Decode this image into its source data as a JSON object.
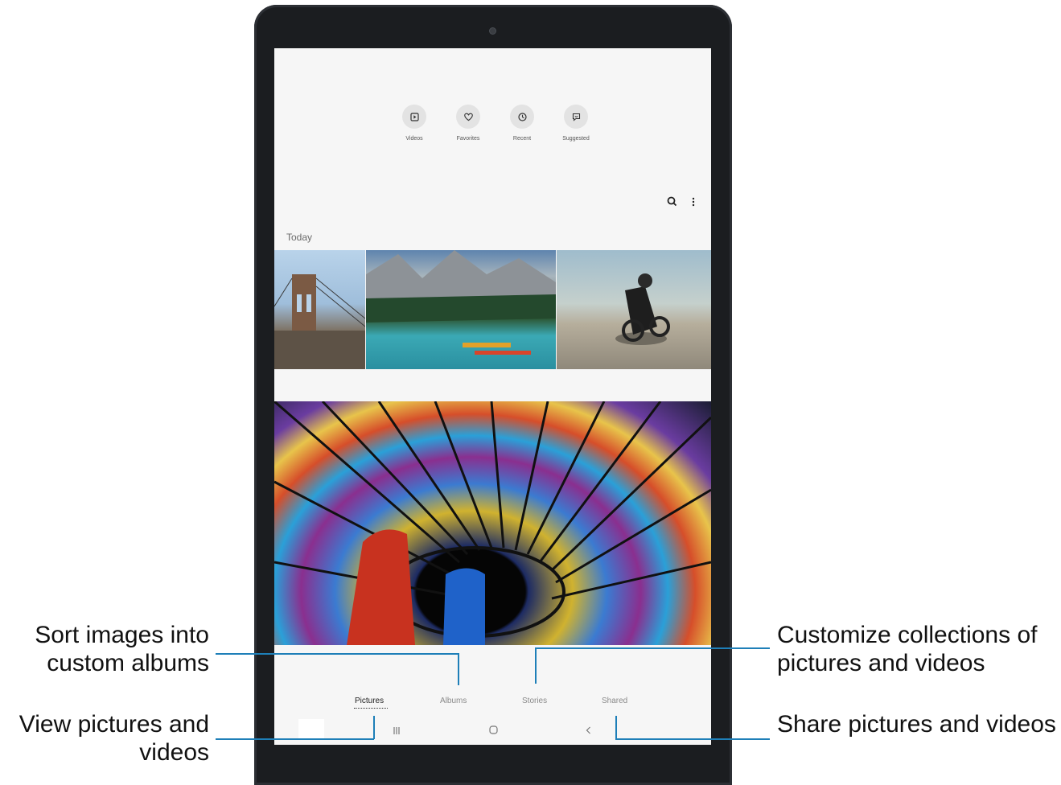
{
  "gallery": {
    "filters": [
      {
        "label": "Videos",
        "icon": "video-icon"
      },
      {
        "label": "Favorites",
        "icon": "heart-icon"
      },
      {
        "label": "Recent",
        "icon": "clock-icon"
      },
      {
        "label": "Suggested",
        "icon": "suggestion-icon"
      }
    ],
    "toolbar": {
      "search_icon": "search-icon",
      "more_icon": "more-vertical-icon"
    },
    "section_title": "Today",
    "tabs": [
      {
        "label": "Pictures",
        "active": true
      },
      {
        "label": "Albums",
        "active": false
      },
      {
        "label": "Stories",
        "active": false
      },
      {
        "label": "Shared",
        "active": false
      }
    ],
    "system_nav": {
      "recents_icon": "recents-icon",
      "home_icon": "home-icon",
      "back_icon": "back-icon"
    }
  },
  "callouts": {
    "albums": "Sort images into custom albums",
    "pictures": "View pictures and videos",
    "stories": "Customize collections of pictures and videos",
    "shared": "Share pictures and videos"
  },
  "colors": {
    "accent_line": "#1e7fb8",
    "device": "#1b1d20",
    "screen": "#f6f6f6"
  }
}
